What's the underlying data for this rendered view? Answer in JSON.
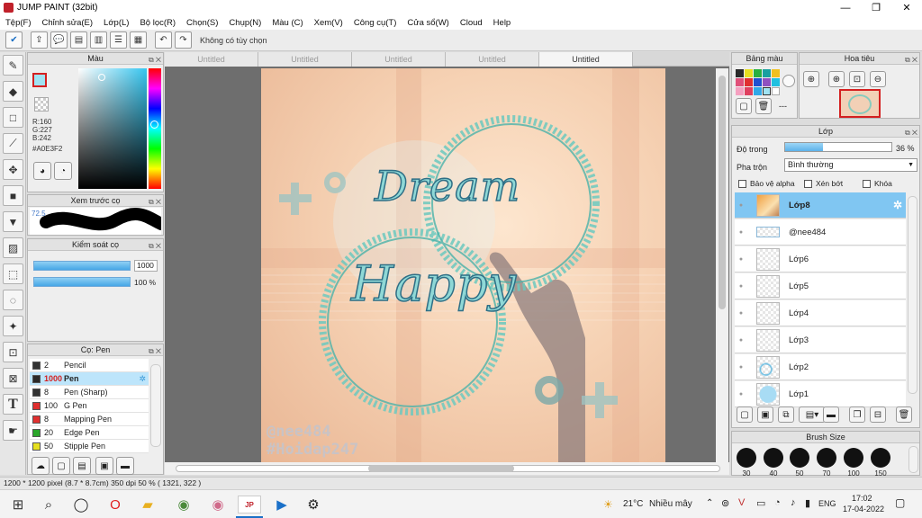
{
  "window": {
    "title": "JUMP PAINT (32bit)"
  },
  "menu": [
    "Tệp(F)",
    "Chỉnh sửa(E)",
    "Lớp(L)",
    "Bộ lọc(R)",
    "Chọn(S)",
    "Chụp(N)",
    "Màu (C)",
    "Xem(V)",
    "Công cụ(T)",
    "Cửa sổ(W)",
    "Cloud",
    "Help"
  ],
  "toolbar": {
    "hint": "Không có tùy chọn"
  },
  "color_panel": {
    "title": "Màu",
    "r": "R:160",
    "g": "G:227",
    "b": "B:242",
    "hex": "#A0E3F2",
    "fg_color": "#a0e3f2"
  },
  "preview_panel": {
    "title": "Xem trước cọ",
    "value": "72.5"
  },
  "control_panel": {
    "title": "Kiểm soát cọ",
    "size_value": "1000",
    "opacity_value": "100 %"
  },
  "brush_panel": {
    "title": "Cọ: Pen",
    "brushes": [
      {
        "size": "2",
        "name": "Pencil",
        "color": "#333333"
      },
      {
        "size": "1000",
        "name": "Pen",
        "color": "#2a2a2a"
      },
      {
        "size": "8",
        "name": "Pen (Sharp)",
        "color": "#333333"
      },
      {
        "size": "100",
        "name": "G Pen",
        "color": "#e03030"
      },
      {
        "size": "8",
        "name": "Mapping Pen",
        "color": "#e03030"
      },
      {
        "size": "20",
        "name": "Edge Pen",
        "color": "#2aa62a"
      },
      {
        "size": "50",
        "name": "Stipple Pen",
        "color": "#e6e020"
      }
    ]
  },
  "tabs": [
    "Untitled",
    "Untitled",
    "Untitled",
    "Untitled",
    "Untitled"
  ],
  "artwork": {
    "word1": "Dream",
    "word2": "Happy",
    "watermark1": "@nee484",
    "watermark2": "#Hoidap247"
  },
  "palette_panel": {
    "title": "Bảng màu"
  },
  "navigator_panel": {
    "title": "Hoa tiêu"
  },
  "layer_panel": {
    "title": "Lớp",
    "opacity_label": "Độ trong",
    "opacity_value": "36 %",
    "opacity_fraction": 0.36,
    "blend_label": "Pha trộn",
    "blend_value": "Bình thường",
    "opt_alpha": "Bảo vệ alpha",
    "opt_clip": "Xén bớt",
    "opt_lock": "Khóa",
    "layers": [
      "Lớp8",
      "@nee484",
      "Lớp6",
      "Lớp5",
      "Lớp4",
      "Lớp3",
      "Lớp2",
      "Lớp1"
    ]
  },
  "brushsize_panel": {
    "title": "Brush Size",
    "sizes": [
      "30",
      "40",
      "50",
      "70",
      "100",
      "150"
    ]
  },
  "status": {
    "text": "1200 * 1200 pixel  (8.7 * 8.7cm)  350 dpi  50 %  ( 1321, 322 )"
  },
  "taskbar": {
    "weather_temp": "21°C",
    "weather_text": "Nhiều mây",
    "lang": "ENG",
    "time": "17:02",
    "date": "17-04-2022"
  }
}
